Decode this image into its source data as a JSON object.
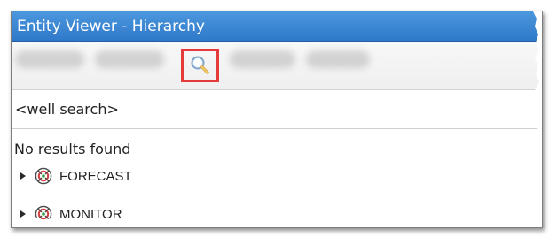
{
  "window": {
    "title": "Entity Viewer - Hierarchy"
  },
  "toolbar": {
    "search_icon": "search-icon"
  },
  "search": {
    "value": "<well search>"
  },
  "results": {
    "message": "No results found",
    "items": [
      {
        "label": "FORECAST",
        "icon": "forecast-icon"
      },
      {
        "label": "MONITOR",
        "icon": "monitor-icon"
      }
    ]
  },
  "colors": {
    "titlebar": "#2f79ca",
    "highlight": "#e53a3a"
  }
}
